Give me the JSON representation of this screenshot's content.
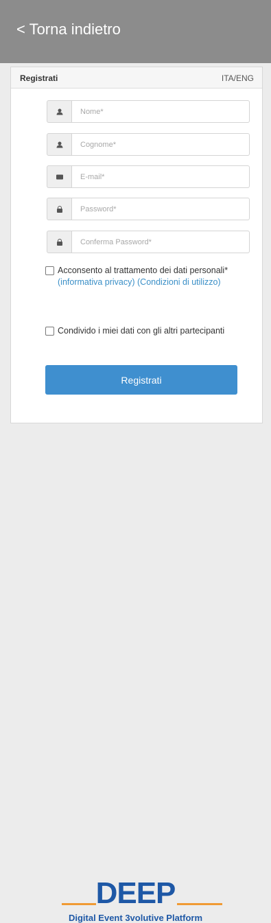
{
  "header": {
    "back_label": "< Torna indietro"
  },
  "card": {
    "title": "Registrati",
    "language_toggle": "ITA/ENG"
  },
  "form": {
    "fields": [
      {
        "icon": "user-icon",
        "placeholder": "Nome*",
        "value": ""
      },
      {
        "icon": "user-icon",
        "placeholder": "Cognome*",
        "value": ""
      },
      {
        "icon": "envelope-icon",
        "placeholder": "E-mail*",
        "value": ""
      },
      {
        "icon": "lock-icon",
        "placeholder": "Password*",
        "value": ""
      },
      {
        "icon": "lock-icon",
        "placeholder": "Conferma Password*",
        "value": ""
      }
    ],
    "consent_text": "Acconsento al trattamento dei dati personali*",
    "privacy_link": "(informativa privacy)",
    "terms_link": "(Condizioni di utilizzo)",
    "share_text": "Condivido i miei dati con gli altri partecipanti",
    "submit_label": "Registrati"
  },
  "logo": {
    "wordmark": "DEEP",
    "tagline": "Digital Event 3volutive Platform"
  },
  "colors": {
    "topbar": "#8c8c8c",
    "primary_button": "#3f8fcf",
    "link": "#3a8fc7",
    "logo_blue": "#1e58a6",
    "logo_orange": "#f09a33"
  }
}
